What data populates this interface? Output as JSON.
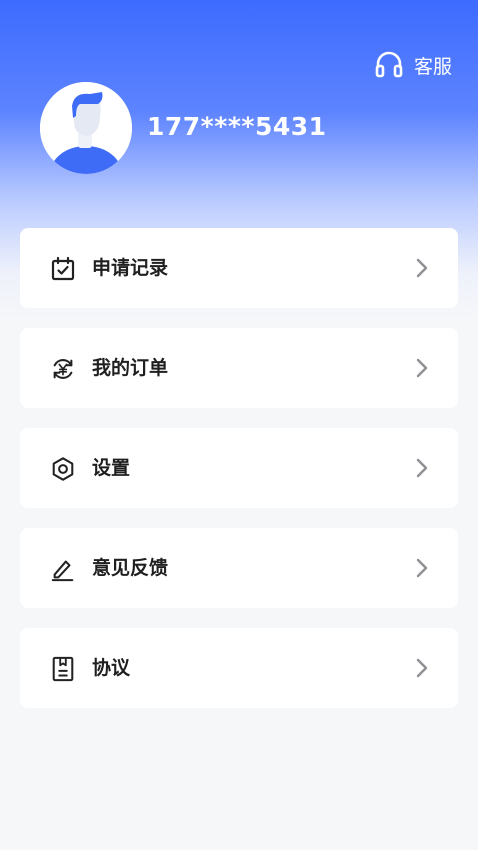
{
  "header": {
    "service_label": "客服",
    "phone": "177****5431"
  },
  "menu": [
    {
      "label": "申请记录",
      "icon": "calendar-check-icon"
    },
    {
      "label": "我的订单",
      "icon": "yen-refresh-icon"
    },
    {
      "label": "设置",
      "icon": "gear-icon"
    },
    {
      "label": "意见反馈",
      "icon": "pencil-icon"
    },
    {
      "label": "协议",
      "icon": "document-icon"
    }
  ],
  "colors": {
    "primary": "#3d6bff",
    "card_bg": "#ffffff",
    "page_bg": "#f6f7f9",
    "text": "#1f1f1f",
    "chevron": "#8e8e93"
  }
}
